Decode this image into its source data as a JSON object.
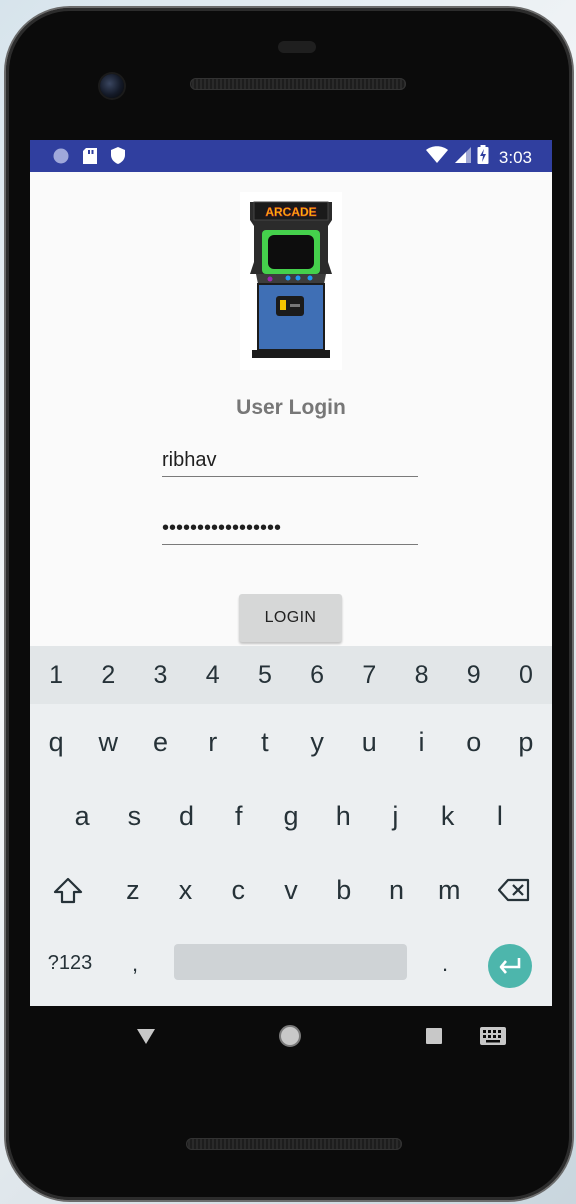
{
  "status_bar": {
    "time": "3:03",
    "left_icons": [
      "circle-icon",
      "sd-card-icon",
      "shield-icon"
    ],
    "right_icons": [
      "wifi-icon",
      "signal-icon",
      "battery-charging-icon"
    ],
    "bg_color": "#303f9f"
  },
  "app": {
    "image_text": "ARCADE",
    "title": "User Login",
    "username_value": "ribhav",
    "password_value": "•••••••••••••••••",
    "login_label": "LOGIN"
  },
  "keyboard": {
    "number_row": [
      "1",
      "2",
      "3",
      "4",
      "5",
      "6",
      "7",
      "8",
      "9",
      "0"
    ],
    "row1": [
      "q",
      "w",
      "e",
      "r",
      "t",
      "y",
      "u",
      "i",
      "o",
      "p"
    ],
    "row2": [
      "a",
      "s",
      "d",
      "f",
      "g",
      "h",
      "j",
      "k",
      "l"
    ],
    "row3": [
      "z",
      "x",
      "c",
      "v",
      "b",
      "n",
      "m"
    ],
    "symbols_label": "?123",
    "comma_label": ",",
    "period_label": ".",
    "enter_color": "#4db6ac"
  },
  "nav_bar": {
    "icons": [
      "back-icon",
      "home-icon",
      "recents-icon",
      "keyboard-switch-icon"
    ]
  }
}
